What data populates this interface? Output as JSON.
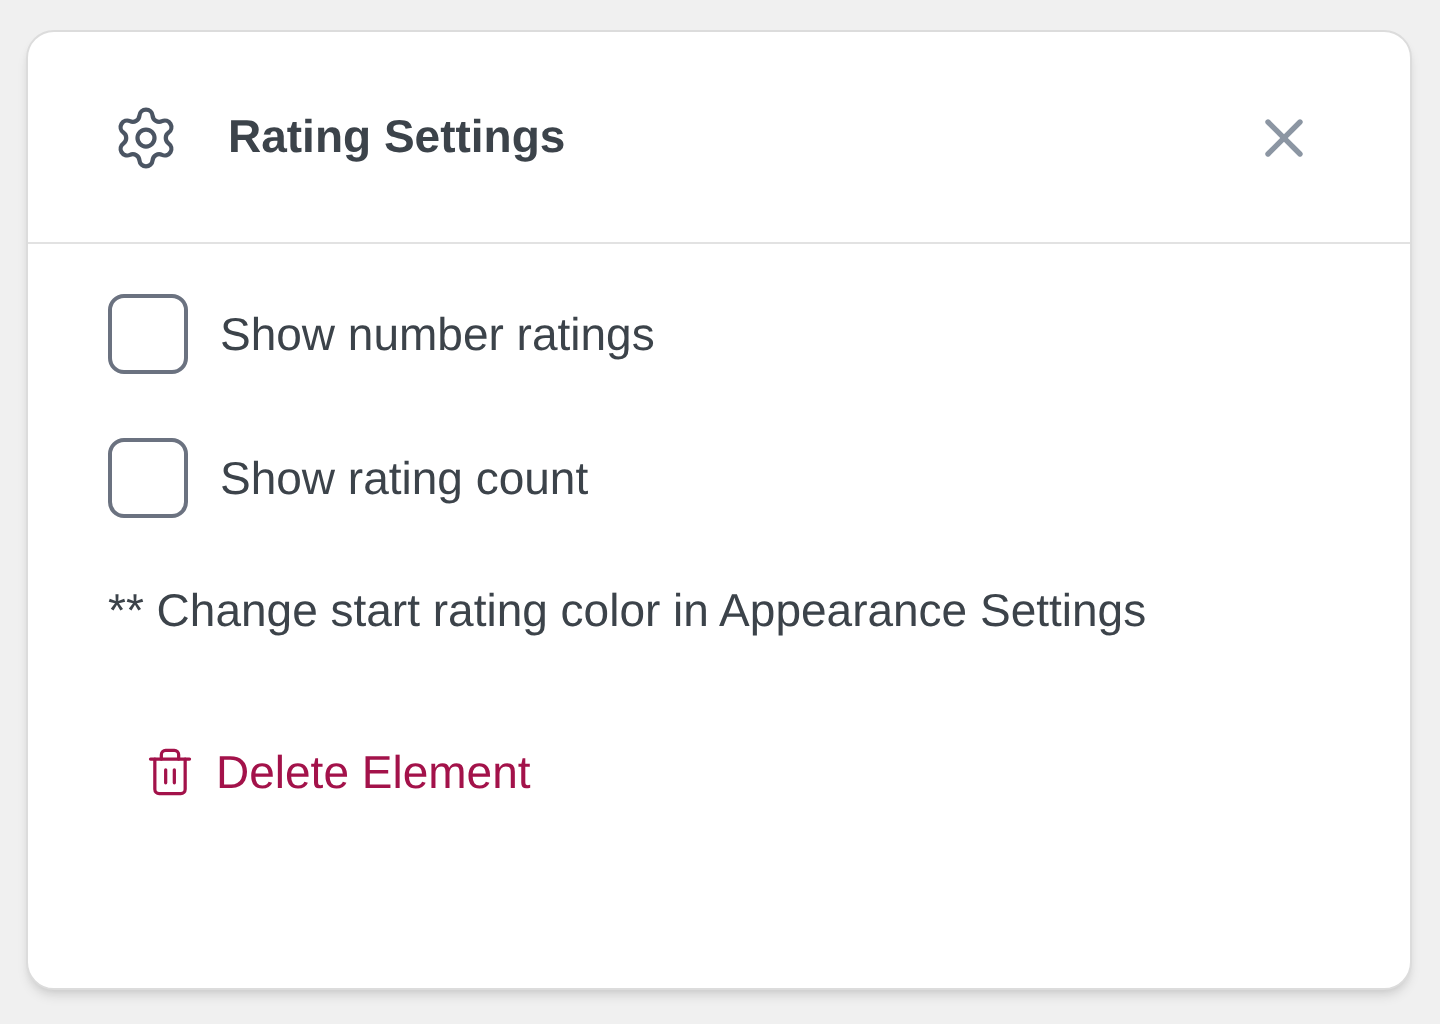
{
  "dialog": {
    "title": "Rating Settings",
    "options": [
      {
        "label": "Show number ratings",
        "checked": false
      },
      {
        "label": "Show rating count",
        "checked": false
      }
    ],
    "note": "** Change start rating color in Appearance Settings",
    "delete_button": "Delete Element"
  }
}
